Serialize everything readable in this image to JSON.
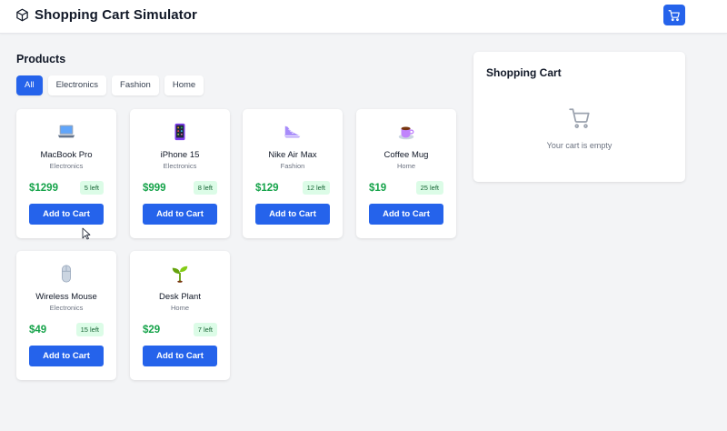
{
  "app": {
    "title": "Shopping Cart Simulator",
    "icon": "package-icon"
  },
  "header": {
    "cart_button_icon": "shopping-cart-icon"
  },
  "products_section": {
    "title": "Products"
  },
  "filters": [
    {
      "label": "All",
      "active": true
    },
    {
      "label": "Electronics",
      "active": false
    },
    {
      "label": "Fashion",
      "active": false
    },
    {
      "label": "Home",
      "active": false
    }
  ],
  "products": [
    {
      "name": "MacBook Pro",
      "category": "Electronics",
      "price": "$1299",
      "stock": "5 left",
      "icon": "laptop-icon",
      "button": "Add to Cart"
    },
    {
      "name": "iPhone 15",
      "category": "Electronics",
      "price": "$999",
      "stock": "8 left",
      "icon": "mobile-phone-icon",
      "button": "Add to Cart"
    },
    {
      "name": "Nike Air Max",
      "category": "Fashion",
      "price": "$129",
      "stock": "12 left",
      "icon": "sneaker-icon",
      "button": "Add to Cart"
    },
    {
      "name": "Coffee Mug",
      "category": "Home",
      "price": "$19",
      "stock": "25 left",
      "icon": "coffee-mug-icon",
      "button": "Add to Cart"
    },
    {
      "name": "Wireless Mouse",
      "category": "Electronics",
      "price": "$49",
      "stock": "15 left",
      "icon": "mouse-icon",
      "button": "Add to Cart"
    },
    {
      "name": "Desk Plant",
      "category": "Home",
      "price": "$29",
      "stock": "7 left",
      "icon": "seedling-icon",
      "button": "Add to Cart"
    }
  ],
  "cart": {
    "title": "Shopping Cart",
    "empty_text": "Your cart is empty",
    "empty_icon": "shopping-cart-icon"
  },
  "colors": {
    "accent": "#2563eb",
    "price": "#16a34a",
    "stock_bg": "#dcfce7",
    "background": "#f3f4f6"
  }
}
